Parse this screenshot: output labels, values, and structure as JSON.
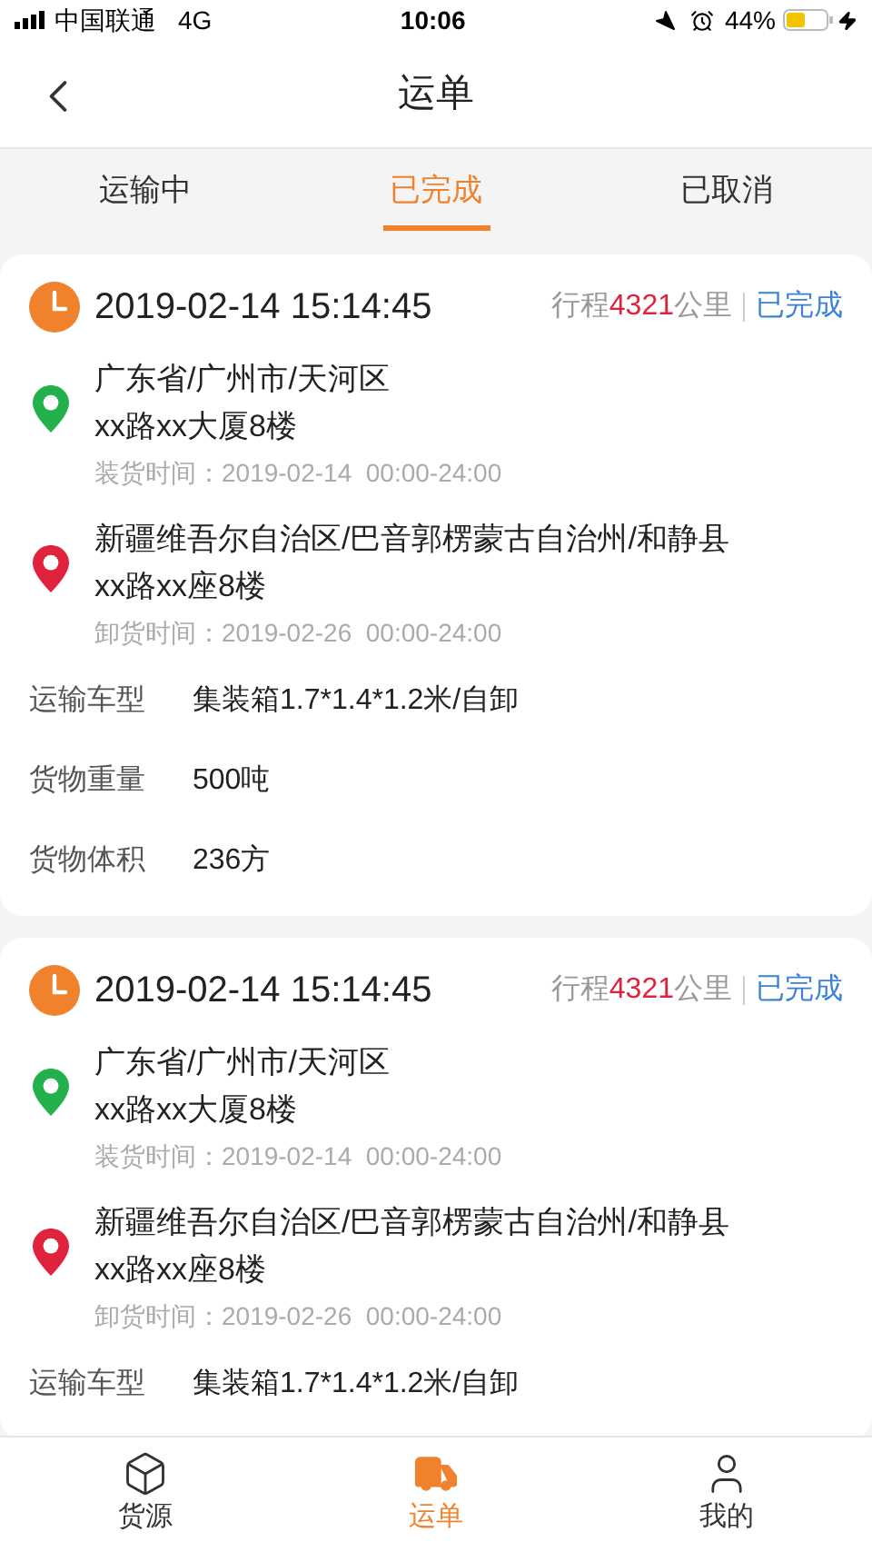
{
  "status_bar": {
    "carrier": "中国联通",
    "network": "4G",
    "time": "10:06",
    "battery": "44%"
  },
  "header": {
    "title": "运单"
  },
  "tabs": [
    {
      "label": "运输中",
      "selected": false
    },
    {
      "label": "已完成",
      "selected": true
    },
    {
      "label": "已取消",
      "selected": false
    }
  ],
  "orders": [
    {
      "datetime": "2019-02-14 15:14:45",
      "distance_prefix": "行程",
      "distance": "4321",
      "distance_unit": "公里",
      "status": "已完成",
      "stops": [
        {
          "kind": "origin",
          "line1": "广东省/广州市/天河区",
          "line2": "xx路xx大厦8楼",
          "time": "装货时间：2019-02-14  00:00-24:00"
        },
        {
          "kind": "destination",
          "line1": "新疆维吾尔自治区/巴音郭楞蒙古自治州/和静县",
          "line2": "xx路xx座8楼",
          "time": "卸货时间：2019-02-26  00:00-24:00"
        }
      ],
      "fields": [
        {
          "label": "运输车型",
          "value": "集装箱1.7*1.4*1.2米/自卸"
        },
        {
          "label": "货物重量",
          "value": "500吨"
        },
        {
          "label": "货物体积",
          "value": "236方"
        }
      ]
    },
    {
      "datetime": "2019-02-14 15:14:45",
      "distance_prefix": "行程",
      "distance": "4321",
      "distance_unit": "公里",
      "status": "已完成",
      "stops": [
        {
          "kind": "origin",
          "line1": "广东省/广州市/天河区",
          "line2": "xx路xx大厦8楼",
          "time": "装货时间：2019-02-14  00:00-24:00"
        },
        {
          "kind": "destination",
          "line1": "新疆维吾尔自治区/巴音郭楞蒙古自治州/和静县",
          "line2": "xx路xx座8楼",
          "time": "卸货时间：2019-02-26  00:00-24:00"
        }
      ],
      "fields": [
        {
          "label": "运输车型",
          "value": "集装箱1.7*1.4*1.2米/自卸"
        }
      ]
    }
  ],
  "nav": [
    {
      "label": "货源",
      "selected": false
    },
    {
      "label": "运单",
      "selected": true
    },
    {
      "label": "我的",
      "selected": false
    }
  ]
}
